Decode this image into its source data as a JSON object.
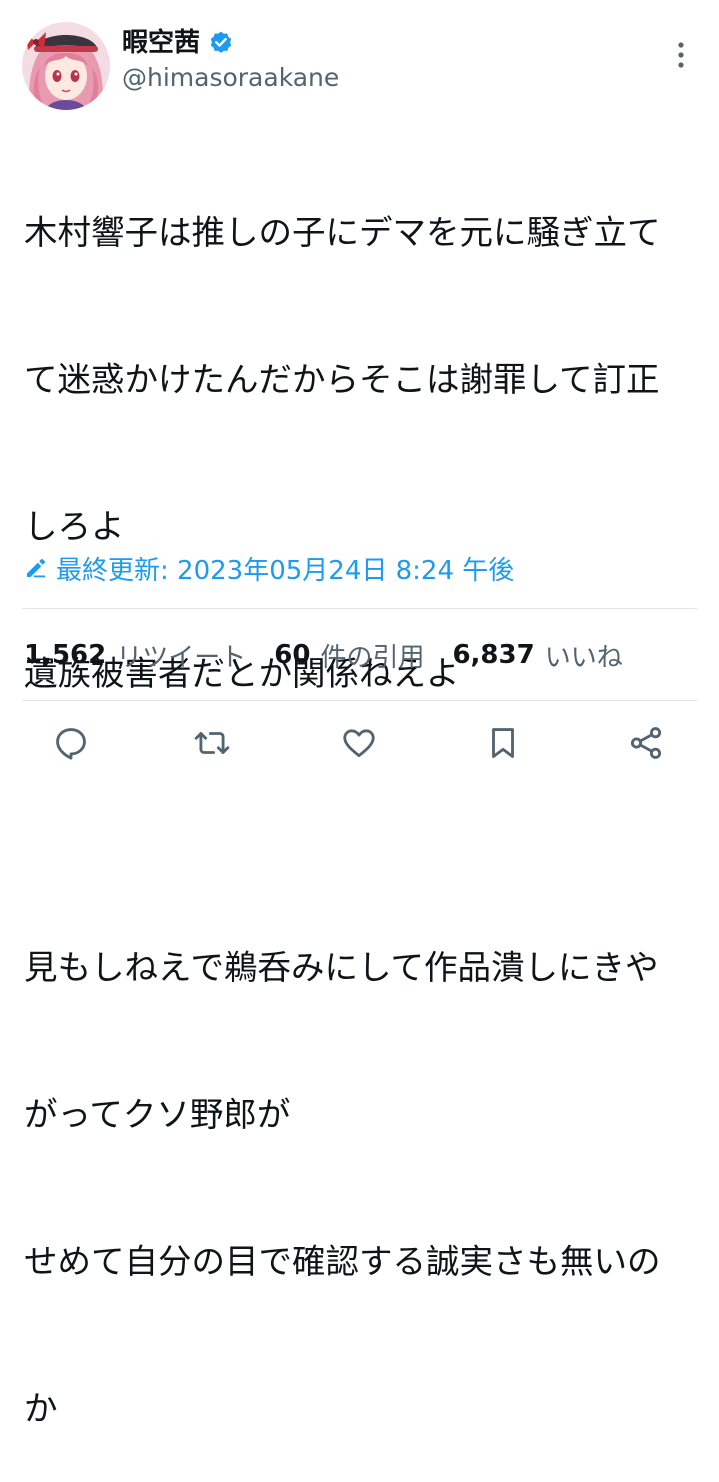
{
  "user": {
    "display_name": "暇空茜",
    "handle": "@himasoraakane",
    "avatar_icon": "anime-girl-avatar",
    "verified_icon": "verified-badge-icon"
  },
  "tweet": {
    "lines": [
      "木村響子は推しの子にデマを元に騒ぎ立て",
      "て迷惑かけたんだからそこは謝罪して訂正",
      "しろよ",
      "遺族被害者だとか関係ねえよ",
      "",
      "見もしねえで鵜呑みにして作品潰しにきや",
      "がってクソ野郎が",
      "せめて自分の目で確認する誠実さも無いの",
      "か"
    ]
  },
  "edited": {
    "label": "最終更新: 2023年05月24日 8:24 午後",
    "icon": "pencil-icon"
  },
  "stats": {
    "retweets_count": "1,562",
    "retweets_label": "リツイート",
    "quotes_count": "60",
    "quotes_label": "件の引用",
    "likes_count": "6,837",
    "likes_label": "いいね"
  },
  "actions": {
    "icons": [
      "reply-icon",
      "retweet-icon",
      "like-icon",
      "bookmark-icon",
      "share-icon"
    ]
  },
  "colors": {
    "accent": "#1d9bf0",
    "text_primary": "#0f1419",
    "text_secondary": "#536471",
    "divider": "#dfe4e8"
  }
}
